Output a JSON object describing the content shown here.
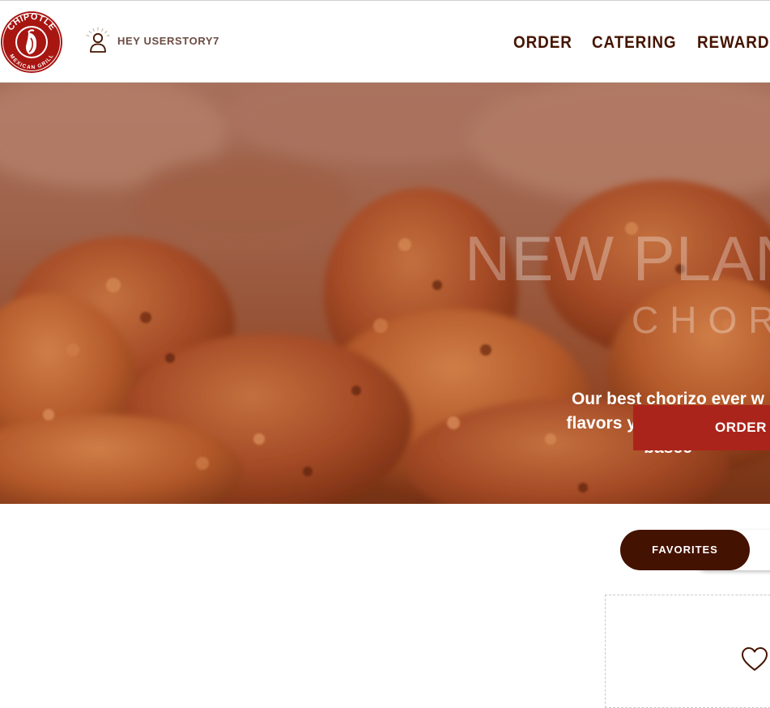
{
  "brand": {
    "logo_text_top": "CHIPOTLE",
    "logo_text_bottom": "MEXICAN GRILL",
    "logo_color": "#a81612"
  },
  "header": {
    "greeting": "HEY USERSTORY7",
    "nav": [
      "ORDER",
      "CATERING",
      "REWARDS"
    ],
    "nav_color": "#451400",
    "icons": {
      "user": "user-account-icon"
    }
  },
  "hero": {
    "headline": "NEW PLAN",
    "subheadline": "CHOR",
    "description_lines": [
      "Our best chorizo ever w",
      "flavors you know and lov",
      "basec"
    ],
    "cta": "ORDER N",
    "cta_color": "#ab241b"
  },
  "favorites": {
    "tab_label": "FAVORITES",
    "tab_color": "#441200",
    "icons": {
      "favorite": "heart-icon"
    }
  }
}
